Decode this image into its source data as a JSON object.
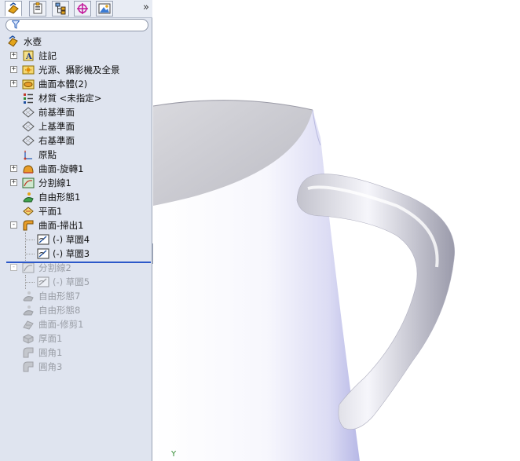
{
  "panel": {
    "tabs": [
      {
        "name": "featuremanager-tab",
        "icon": "featuremanager-icon"
      },
      {
        "name": "propertymanager-tab",
        "icon": "propertymanager-icon"
      },
      {
        "name": "configurationmanager-tab",
        "icon": "configurationmanager-icon"
      },
      {
        "name": "dimxpertmanager-tab",
        "icon": "dimxpertmanager-icon"
      },
      {
        "name": "displaymanager-tab",
        "icon": "displaymanager-icon"
      }
    ],
    "more": "»",
    "filter_icon": "filter-icon",
    "tree_root": "水壺",
    "items": [
      {
        "label": "註記",
        "expand": "+",
        "icon": "annotations-icon",
        "dim": false
      },
      {
        "label": "光源、攝影機及全景",
        "expand": "+",
        "icon": "lights-cameras-icon",
        "dim": false
      },
      {
        "label": "曲面本體(2)",
        "expand": "+",
        "icon": "surface-bodies-icon",
        "dim": false
      },
      {
        "label": "材質 <未指定>",
        "expand": "",
        "icon": "material-icon",
        "dim": false
      },
      {
        "label": "前基準面",
        "expand": "",
        "icon": "plane-icon",
        "dim": false
      },
      {
        "label": "上基準面",
        "expand": "",
        "icon": "plane-icon",
        "dim": false
      },
      {
        "label": "右基準面",
        "expand": "",
        "icon": "plane-icon",
        "dim": false
      },
      {
        "label": "原點",
        "expand": "",
        "icon": "origin-icon",
        "dim": false
      },
      {
        "label": "曲面-旋轉1",
        "expand": "+",
        "icon": "surface-revolve-icon",
        "dim": false
      },
      {
        "label": "分割線1",
        "expand": "+",
        "icon": "split-line-icon",
        "dim": false
      },
      {
        "label": "自由形態1",
        "expand": "",
        "icon": "freeform-icon",
        "dim": false
      },
      {
        "label": "平面1",
        "expand": "",
        "icon": "planar-surface-icon",
        "dim": false
      },
      {
        "label": "曲面-掃出1",
        "expand": "-",
        "icon": "surface-sweep-icon",
        "dim": false
      },
      {
        "label": "(-) 草圖4",
        "expand": "",
        "icon": "sketch-icon",
        "dim": false,
        "child": true
      },
      {
        "label": "(-) 草圖3",
        "expand": "",
        "icon": "sketch-icon",
        "dim": false,
        "child": true
      },
      {
        "label": "分割線2",
        "expand": "-",
        "icon": "split-line-icon",
        "dim": true
      },
      {
        "label": "(-) 草圖5",
        "expand": "",
        "icon": "sketch-icon",
        "dim": true,
        "child": true
      },
      {
        "label": "自由形態7",
        "expand": "",
        "icon": "freeform-icon",
        "dim": true
      },
      {
        "label": "自由形態8",
        "expand": "",
        "icon": "freeform-icon",
        "dim": true
      },
      {
        "label": "曲面-修剪1",
        "expand": "",
        "icon": "surface-trim-icon",
        "dim": true
      },
      {
        "label": "厚面1",
        "expand": "",
        "icon": "thicken-icon",
        "dim": true
      },
      {
        "label": "圓角1",
        "expand": "",
        "icon": "fillet-icon",
        "dim": true
      },
      {
        "label": "圓角3",
        "expand": "",
        "icon": "fillet-icon",
        "dim": true
      }
    ]
  },
  "viewport": {
    "axis_label": "Y",
    "model_color": "#c9cbe0",
    "accent": "#2c58c9"
  }
}
